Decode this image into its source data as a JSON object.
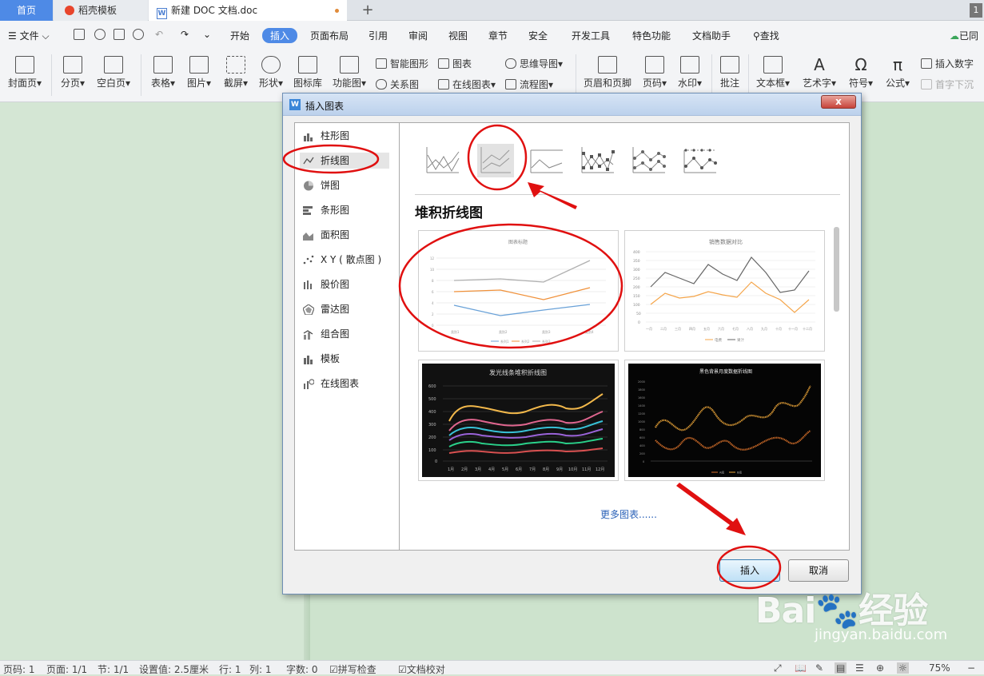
{
  "tabs": {
    "home": "首页",
    "templates": "稻壳模板",
    "document": "新建 DOC 文档.doc",
    "add": "+",
    "count": "1"
  },
  "menu": {
    "file": "文件",
    "items": [
      "开始",
      "插入",
      "页面布局",
      "引用",
      "审阅",
      "视图",
      "章节",
      "安全",
      "开发工具",
      "特色功能",
      "文档助手"
    ],
    "search": "查找",
    "cloud": "已同"
  },
  "ribbon": {
    "cover": "封面页",
    "page_break": "分页",
    "blank_page": "空白页",
    "table": "表格",
    "picture": "图片",
    "screenshot": "截屏",
    "shape": "形状",
    "icon_lib": "图标库",
    "function_chart": "功能图",
    "smart_shape": "智能图形",
    "chart": "图表",
    "mindmap": "思维导图",
    "relation": "关系图",
    "online_chart": "在线图表",
    "flowchart": "流程图",
    "header_footer": "页眉和页脚",
    "page_number": "页码",
    "watermark": "水印",
    "comment": "批注",
    "textbox": "文本框",
    "art_text": "艺术字",
    "symbol": "符号",
    "formula": "公式",
    "insert_number": "插入数字",
    "drop_cap": "首字下沉"
  },
  "status": {
    "page_code": "页码: 1",
    "page": "页面: 1/1",
    "section": "节: 1/1",
    "setting": "设置值: 2.5厘米",
    "row": "行: 1",
    "col": "列: 1",
    "words": "字数: 0",
    "spell": "拼写检查",
    "proof": "文档校对",
    "zoom": "75%"
  },
  "dialog": {
    "title": "插入图表",
    "close": "x",
    "categories": [
      "柱形图",
      "折线图",
      "饼图",
      "条形图",
      "面积图",
      "X Y ( 散点图 )",
      "股价图",
      "雷达图",
      "组合图",
      "模板",
      "在线图表"
    ],
    "selected_category": "折线图",
    "section_title": "堆积折线图",
    "more_charts": "更多图表......",
    "insert_button": "插入",
    "cancel_button": "取消"
  },
  "thumbnails": {
    "t1": {
      "title": "图表标题",
      "ylabels": [
        "12",
        "10",
        "8",
        "6",
        "4",
        "2",
        "0"
      ],
      "xlabels": [
        "类别1",
        "类别2",
        "类别3",
        "类别4"
      ],
      "legend": [
        "系列1",
        "系列2",
        "系列3"
      ]
    },
    "t2": {
      "title": "销售数据对比",
      "ylabels": [
        "400",
        "350",
        "300",
        "250",
        "200",
        "150",
        "100",
        "50",
        "0"
      ],
      "xlabels": [
        "一月",
        "二月",
        "三月",
        "四月",
        "五月",
        "六月",
        "七月",
        "八月",
        "九月",
        "十月",
        "十一月",
        "十二月"
      ],
      "legend": [
        "电费",
        "果汁"
      ]
    },
    "t3": {
      "title": "发光线条堆积折线图",
      "ylabels": [
        "600",
        "500",
        "400",
        "300",
        "200",
        "100",
        "0"
      ],
      "xlabels": [
        "1月",
        "2月",
        "3月",
        "4月",
        "5月",
        "6月",
        "7月",
        "8月",
        "9月",
        "10月",
        "11月",
        "12月"
      ]
    },
    "t4": {
      "title": "黑色背景月度数据折线图",
      "ylabels": [
        "2000",
        "1800",
        "1600",
        "1400",
        "1200",
        "1000",
        "800",
        "600",
        "400",
        "200",
        "0"
      ],
      "legend": [
        "A组",
        "B组"
      ]
    }
  },
  "watermark": {
    "brand": "Bai",
    "brand_suffix": "经验",
    "url": "jingyan.baidu.com"
  }
}
